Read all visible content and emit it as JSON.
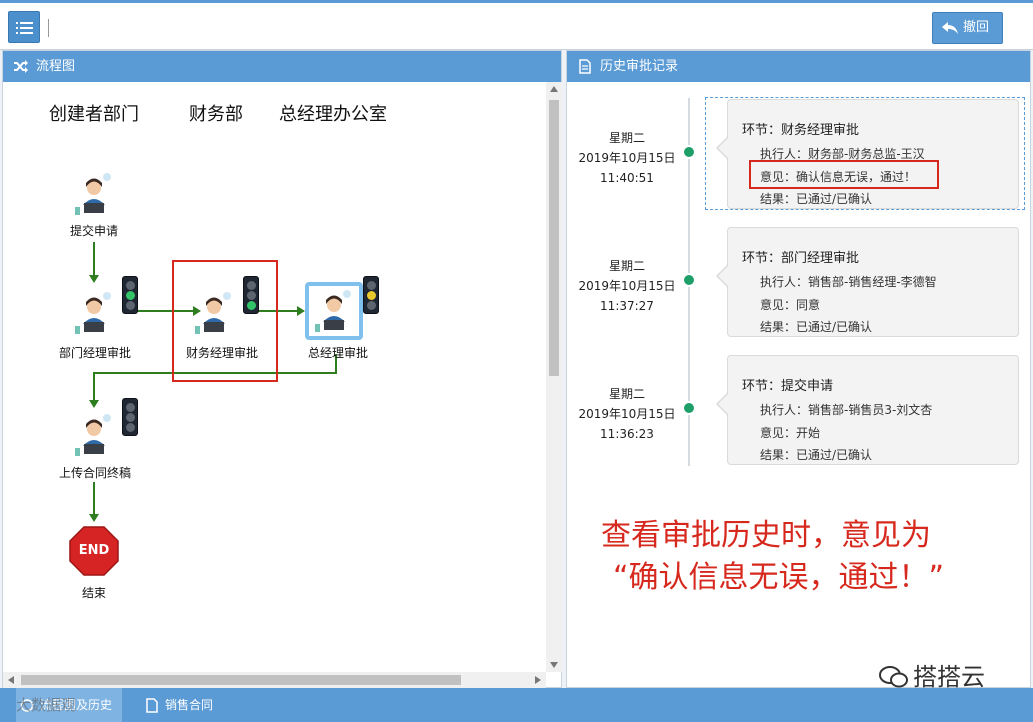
{
  "toolbar": {
    "revoke_label": "撤回"
  },
  "flow_panel": {
    "title": "流程图",
    "lanes": [
      "创建者部门",
      "财务部",
      "总经理办公室"
    ],
    "nodes": {
      "submit": "提交申请",
      "dept_manager": "部门经理审批",
      "finance_manager": "财务经理审批",
      "general_manager": "总经理审批",
      "upload_contract": "上传合同终稿",
      "end_badge": "END",
      "end": "结束"
    }
  },
  "history_panel": {
    "title": "历史审批记录",
    "records": [
      {
        "weekday": "星期二",
        "date": "2019年10月15日",
        "time": "11:40:51",
        "step": "环节：财务经理审批",
        "operator": "执行人：财务部-财务总监-王汉",
        "opinion": "意见：确认信息无误，通过！",
        "result": "结果：已通过/已确认",
        "highlighted": true
      },
      {
        "weekday": "星期二",
        "date": "2019年10月15日",
        "time": "11:37:27",
        "step": "环节：部门经理审批",
        "operator": "执行人：销售部-销售经理-李德智",
        "opinion": "意见：同意",
        "result": "结果：已通过/已确认",
        "highlighted": false
      },
      {
        "weekday": "星期二",
        "date": "2019年10月15日",
        "time": "11:36:23",
        "step": "环节：提交申请",
        "operator": "执行人：销售部-销售员3-刘文杏",
        "opinion": "意见：开始",
        "result": "结果：已通过/已确认",
        "highlighted": false
      }
    ],
    "annotation_line1": "查看审批历史时，意见为",
    "annotation_line2": "“确认信息无误，通过！”",
    "brand": "搭搭云"
  },
  "bottom_bar": {
    "tabs": [
      "流程图及历史",
      "销售合同"
    ],
    "watermark": "大数据观"
  },
  "colors": {
    "accent": "#5b9bd5",
    "flow_line": "#2e7d1f",
    "highlight_red": "#d7281e",
    "timeline_dot": "#1e9f68"
  }
}
